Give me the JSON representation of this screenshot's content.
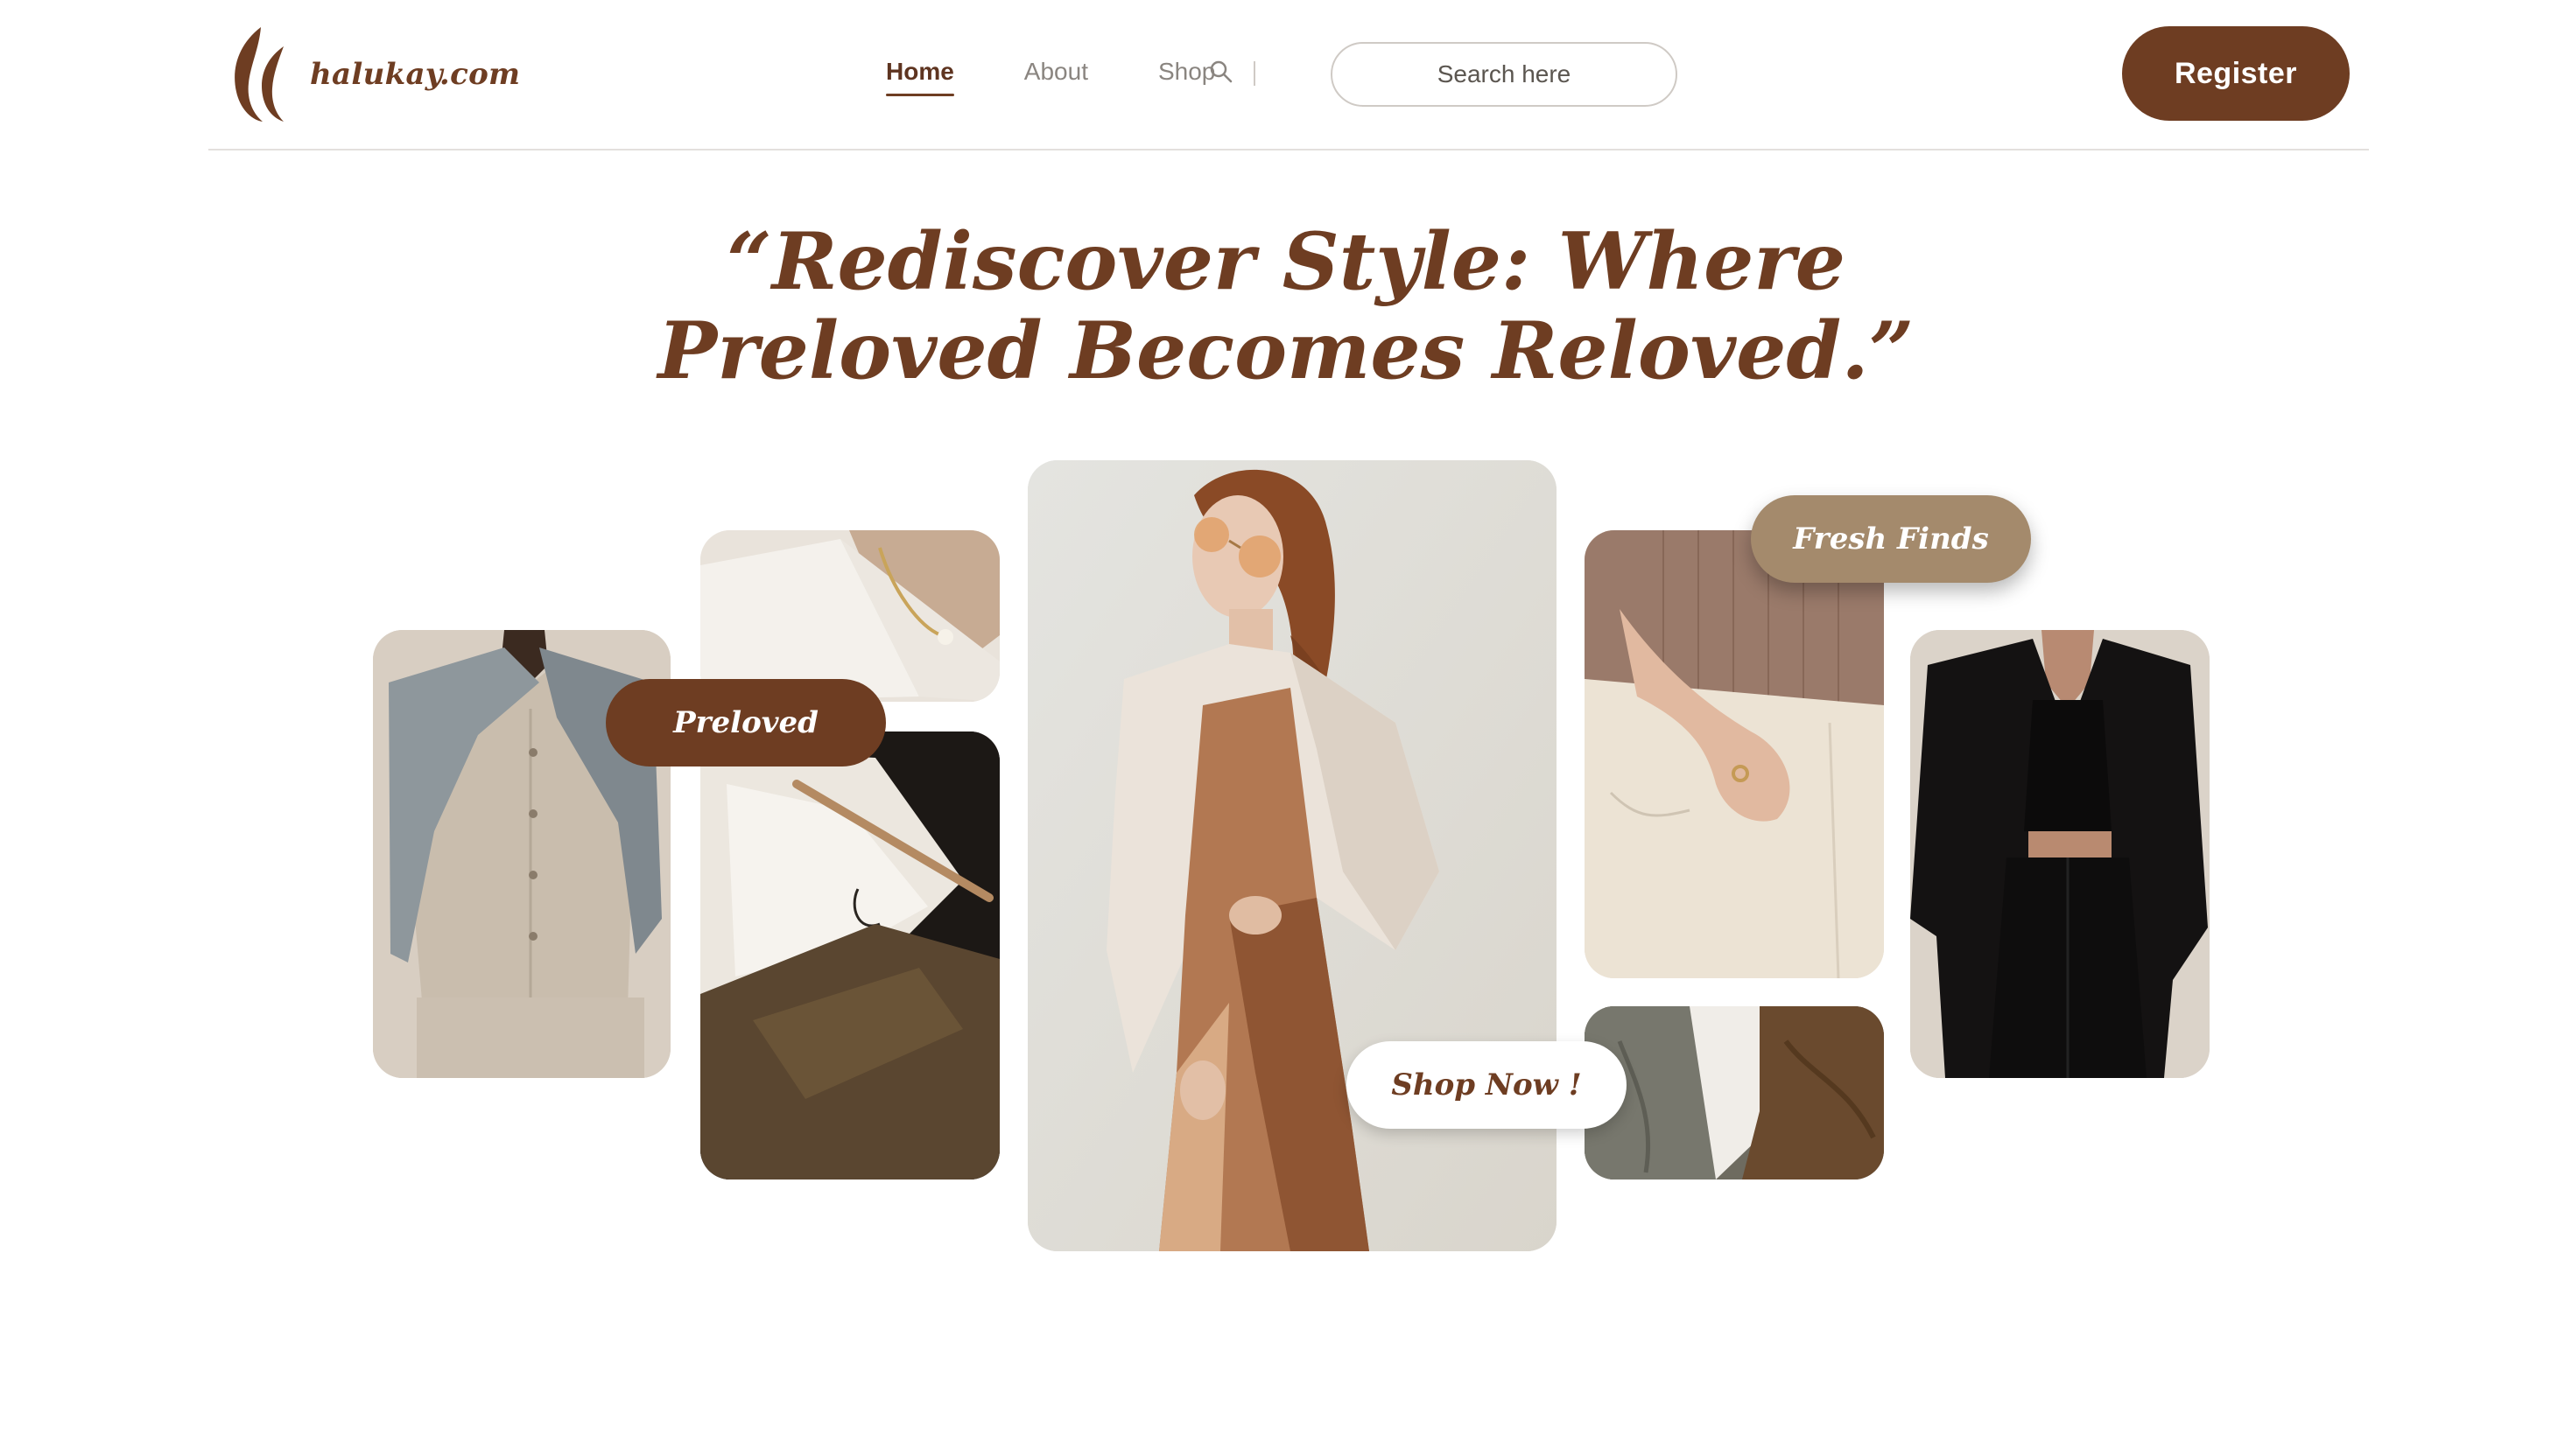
{
  "brand": {
    "name": "halukay.com",
    "color": "#6e3d22"
  },
  "nav": {
    "items": [
      {
        "label": "Home",
        "active": true
      },
      {
        "label": "About",
        "active": false
      },
      {
        "label": "Shop",
        "active": false
      }
    ]
  },
  "search": {
    "placeholder": "Search here",
    "value": ""
  },
  "register": {
    "label": "Register"
  },
  "hero": {
    "line1": "“Rediscover Style: Where",
    "line2": "Preloved Becomes Reloved.”"
  },
  "badges": {
    "preloved": "Preloved",
    "fresh": "Fresh Finds",
    "shop_now": "Shop Now !"
  },
  "colors": {
    "brand": "#6e3d22",
    "fresh_badge": "#a48a6c",
    "white": "#ffffff"
  },
  "icons": [
    "logo-mark-icon",
    "search-icon"
  ]
}
